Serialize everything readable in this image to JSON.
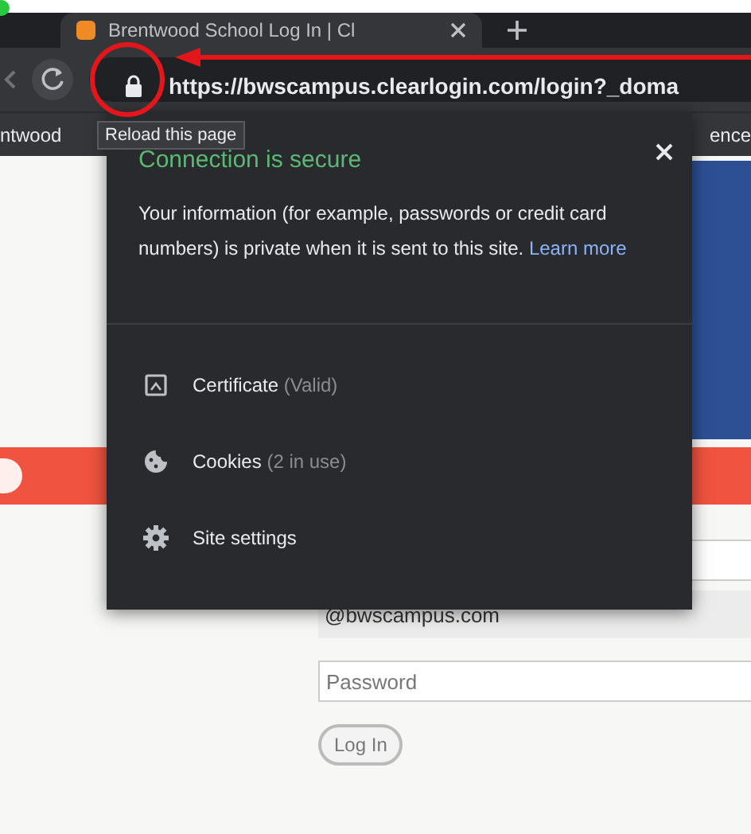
{
  "browser": {
    "tab": {
      "title": "Brentwood School Log In | Cl"
    },
    "address": "https://bwscampus.clearlogin.com/login?_doma",
    "tooltip": "Reload this page",
    "bookmarks": [
      "ntwood",
      "ence"
    ]
  },
  "popup": {
    "title": "Connection is secure",
    "message": "Your information (for example, passwords or credit card numbers) is private when it is sent to this site.",
    "link": "Learn more",
    "items": [
      {
        "kind": "certificate",
        "label": "Certificate",
        "detail": "(Valid)"
      },
      {
        "kind": "cookies",
        "label": "Cookies",
        "detail": "(2 in use)"
      },
      {
        "kind": "settings",
        "label": "Site settings"
      }
    ]
  },
  "login": {
    "username": "@bwscampus.com",
    "password_placeholder": "Password",
    "button": "Log In"
  }
}
